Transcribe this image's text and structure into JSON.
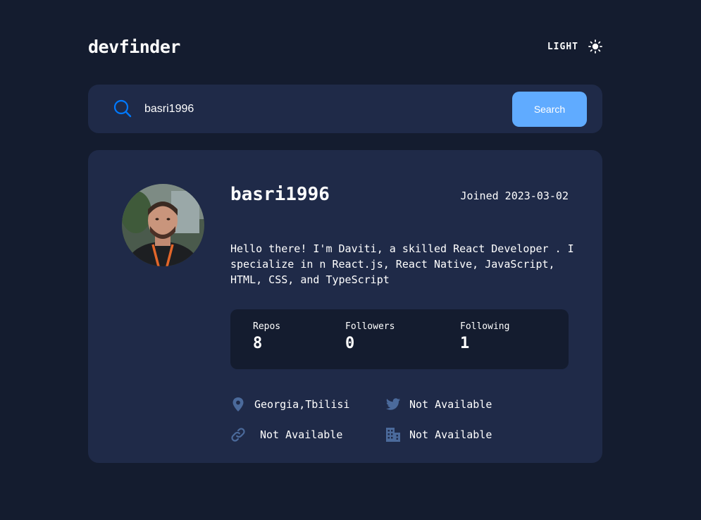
{
  "header": {
    "logo": "devfinder",
    "theme_label": "LIGHT",
    "theme_icon": "sun-icon"
  },
  "search": {
    "value": "basri1996",
    "icon": "search-icon",
    "button_label": "Search"
  },
  "profile": {
    "username": "basri1996",
    "joined": "Joined 2023-03-02",
    "bio": "Hello there! I'm Daviti, a skilled React Developer . I specialize in n React.js, React Native, JavaScript, HTML, CSS, and TypeScript",
    "stats": [
      {
        "label": "Repos",
        "value": "8"
      },
      {
        "label": "Followers",
        "value": "0"
      },
      {
        "label": "Following",
        "value": "1"
      }
    ],
    "links": {
      "location": {
        "icon": "location-pin-icon",
        "text": "Georgia,Tbilisi"
      },
      "twitter": {
        "icon": "twitter-icon",
        "text": "Not Available"
      },
      "blog": {
        "icon": "link-icon",
        "text": "Not Available"
      },
      "company": {
        "icon": "building-icon",
        "text": "Not Available"
      }
    }
  },
  "colors": {
    "background": "#141c2f",
    "card": "#1f2a48",
    "accent": "#60abff",
    "icon": "#4b6a9b"
  }
}
